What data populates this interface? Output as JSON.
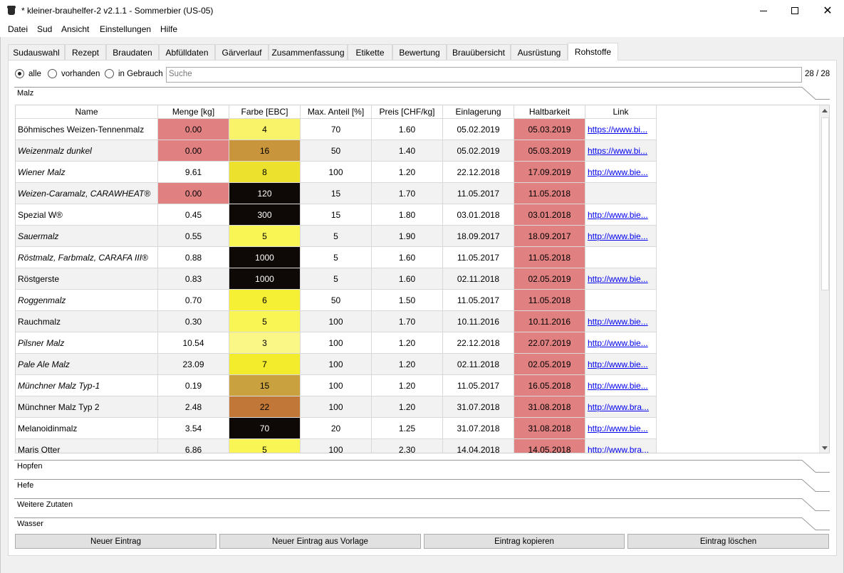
{
  "window": {
    "title": "* kleiner-brauhelfer-2 v2.1.1 - Sommerbier (US-05)"
  },
  "menu": [
    "Datei",
    "Sud",
    "Ansicht",
    "Einstellungen",
    "Hilfe"
  ],
  "tabs": [
    "Sudauswahl",
    "Rezept",
    "Braudaten",
    "Abfülldaten",
    "Gärverlauf",
    "Zusammenfassung",
    "Etikette",
    "Bewertung",
    "Brauübersicht",
    "Ausrüstung",
    "Rohstoffe"
  ],
  "active_tab": "Rohstoffe",
  "filter": {
    "options": [
      "alle",
      "vorhanden",
      "in Gebrauch"
    ],
    "selected": "alle",
    "search_placeholder": "Suche",
    "count": "28 / 28"
  },
  "sections": {
    "malz": "Malz",
    "hopfen": "Hopfen",
    "hefe": "Hefe",
    "weitere": "Weitere Zutaten",
    "wasser": "Wasser"
  },
  "table": {
    "columns": [
      "Name",
      "Menge [kg]",
      "Farbe [EBC]",
      "Max. Anteil [%]",
      "Preis [CHF/kg]",
      "Einlagerung",
      "Haltbarkeit",
      "Link"
    ],
    "rows": [
      {
        "name": "Böhmisches Weizen-Tennenmalz",
        "italic": false,
        "menge": "0.00",
        "farbe": "4",
        "anteil": "70",
        "preis": "1.60",
        "einlagerung": "05.02.2019",
        "haltbarkeit": "05.03.2019",
        "link": "https://www.bi..."
      },
      {
        "name": "Weizenmalz dunkel",
        "italic": true,
        "menge": "0.00",
        "farbe": "16",
        "anteil": "50",
        "preis": "1.40",
        "einlagerung": "05.02.2019",
        "haltbarkeit": "05.03.2019",
        "link": "https://www.bi..."
      },
      {
        "name": "Wiener Malz",
        "italic": true,
        "menge": "9.61",
        "farbe": "8",
        "anteil": "100",
        "preis": "1.20",
        "einlagerung": "22.12.2018",
        "haltbarkeit": "17.09.2019",
        "link": "http://www.bie..."
      },
      {
        "name": "Weizen-Caramalz, CARAWHEAT®",
        "italic": true,
        "menge": "0.00",
        "farbe": "120",
        "anteil": "15",
        "preis": "1.70",
        "einlagerung": "11.05.2017",
        "haltbarkeit": "11.05.2018",
        "link": ""
      },
      {
        "name": "Spezial W®",
        "italic": false,
        "menge": "0.45",
        "farbe": "300",
        "anteil": "15",
        "preis": "1.80",
        "einlagerung": "03.01.2018",
        "haltbarkeit": "03.01.2018",
        "link": "http://www.bie..."
      },
      {
        "name": "Sauermalz",
        "italic": true,
        "menge": "0.55",
        "farbe": "5",
        "anteil": "5",
        "preis": "1.90",
        "einlagerung": "18.09.2017",
        "haltbarkeit": "18.09.2017",
        "link": "http://www.bie..."
      },
      {
        "name": "Röstmalz, Farbmalz, CARAFA III®",
        "italic": true,
        "menge": "0.88",
        "farbe": "1000",
        "anteil": "5",
        "preis": "1.60",
        "einlagerung": "11.05.2017",
        "haltbarkeit": "11.05.2018",
        "link": ""
      },
      {
        "name": "Röstgerste",
        "italic": false,
        "menge": "0.83",
        "farbe": "1000",
        "anteil": "5",
        "preis": "1.60",
        "einlagerung": "02.11.2018",
        "haltbarkeit": "02.05.2019",
        "link": "http://www.bie..."
      },
      {
        "name": "Roggenmalz",
        "italic": true,
        "menge": "0.70",
        "farbe": "6",
        "anteil": "50",
        "preis": "1.50",
        "einlagerung": "11.05.2017",
        "haltbarkeit": "11.05.2018",
        "link": ""
      },
      {
        "name": "Rauchmalz",
        "italic": false,
        "menge": "0.30",
        "farbe": "5",
        "anteil": "100",
        "preis": "1.70",
        "einlagerung": "10.11.2016",
        "haltbarkeit": "10.11.2016",
        "link": "http://www.bie..."
      },
      {
        "name": "Pilsner Malz",
        "italic": true,
        "menge": "10.54",
        "farbe": "3",
        "anteil": "100",
        "preis": "1.20",
        "einlagerung": "22.12.2018",
        "haltbarkeit": "22.07.2019",
        "link": "http://www.bie..."
      },
      {
        "name": "Pale Ale Malz",
        "italic": true,
        "menge": "23.09",
        "farbe": "7",
        "anteil": "100",
        "preis": "1.20",
        "einlagerung": "02.11.2018",
        "haltbarkeit": "02.05.2019",
        "link": "http://www.bie..."
      },
      {
        "name": "Münchner Malz Typ-1",
        "italic": true,
        "menge": "0.19",
        "farbe": "15",
        "anteil": "100",
        "preis": "1.20",
        "einlagerung": "11.05.2017",
        "haltbarkeit": "16.05.2018",
        "link": "http://www.bie..."
      },
      {
        "name": "Münchner Malz Typ 2",
        "italic": false,
        "menge": "2.48",
        "farbe": "22",
        "anteil": "100",
        "preis": "1.20",
        "einlagerung": "31.07.2018",
        "haltbarkeit": "31.08.2018",
        "link": "http://www.bra..."
      },
      {
        "name": "Melanoidinmalz",
        "italic": false,
        "menge": "3.54",
        "farbe": "70",
        "anteil": "20",
        "preis": "1.25",
        "einlagerung": "31.07.2018",
        "haltbarkeit": "31.08.2018",
        "link": "http://www.bie..."
      },
      {
        "name": "Maris Otter",
        "italic": false,
        "menge": "6.86",
        "farbe": "5",
        "anteil": "100",
        "preis": "2.30",
        "einlagerung": "14.04.2018",
        "haltbarkeit": "14.05.2018",
        "link": "http://www.bra..."
      }
    ]
  },
  "buttons": [
    "Neuer Eintrag",
    "Neuer Eintrag aus Vorlage",
    "Eintrag kopieren",
    "Eintrag löschen"
  ],
  "colors": {
    "warn_red": "#e08080",
    "ebc": {
      "3": "#fbf787",
      "4": "#f9f36a",
      "5": "#f8f555",
      "6": "#f5f033",
      "7": "#f2ec2c",
      "8": "#ece22e",
      "15": "#c9a13e",
      "16": "#c8953c",
      "22": "#c07738",
      "70": "#0e0806",
      "120": "#0e0806",
      "300": "#0e0806",
      "1000": "#0e0806"
    }
  }
}
